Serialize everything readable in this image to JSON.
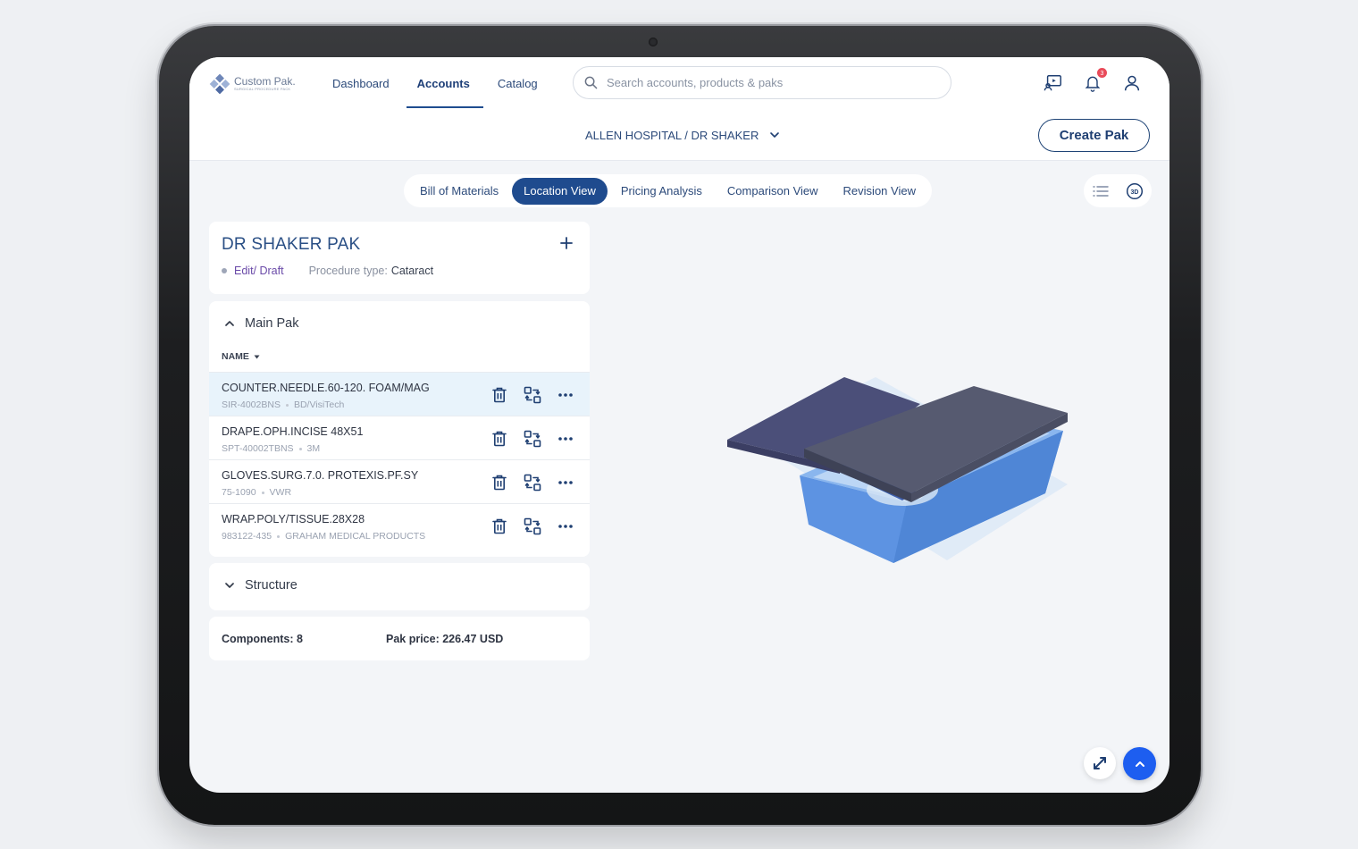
{
  "app": {
    "logo_name": "Custom Pak.",
    "logo_tagline": "SURGICAL PROCEDURE PACK"
  },
  "nav": [
    {
      "label": "Dashboard"
    },
    {
      "label": "Accounts"
    },
    {
      "label": "Catalog"
    }
  ],
  "search": {
    "placeholder": "Search accounts, products & paks"
  },
  "header": {
    "notification_count": "3",
    "breadcrumb": "ALLEN HOSPITAL / DR SHAKER",
    "create_label": "Create Pak"
  },
  "tabs": [
    {
      "label": "Bill of Materials"
    },
    {
      "label": "Location View"
    },
    {
      "label": "Pricing Analysis"
    },
    {
      "label": "Comparison View"
    },
    {
      "label": "Revision View"
    }
  ],
  "pak": {
    "title": "DR SHAKER PAK",
    "status": "Edit/ Draft",
    "procedure_label": "Procedure type:",
    "procedure_value": "Cataract"
  },
  "main_pak": {
    "title": "Main Pak",
    "column": "NAME",
    "items": [
      {
        "name": "COUNTER.NEEDLE.60-120. FOAM/MAG",
        "code": "SIR-4002BNS",
        "vendor": "BD/VisiTech"
      },
      {
        "name": "DRAPE.OPH.INCISE 48X51",
        "code": "SPT-40002TBNS",
        "vendor": "3M"
      },
      {
        "name": "GLOVES.SURG.7.0. PROTEXIS.PF.SY",
        "code": "75-1090",
        "vendor": "VWR"
      },
      {
        "name": "WRAP.POLY/TISSUE.28X28",
        "code": "983122-435",
        "vendor": "GRAHAM MEDICAL PRODUCTS"
      }
    ]
  },
  "structure": {
    "title": "Structure"
  },
  "summary": {
    "components": "Components: 8",
    "price": "Pak price: 226.47 USD"
  },
  "view_toggle": {
    "icon_3d": "3D"
  },
  "colors": {
    "primary": "#1f4b8e",
    "accent_blue": "#1d5ef0",
    "selected_row": "#e8f3fb",
    "badge": "#e94b5a"
  }
}
